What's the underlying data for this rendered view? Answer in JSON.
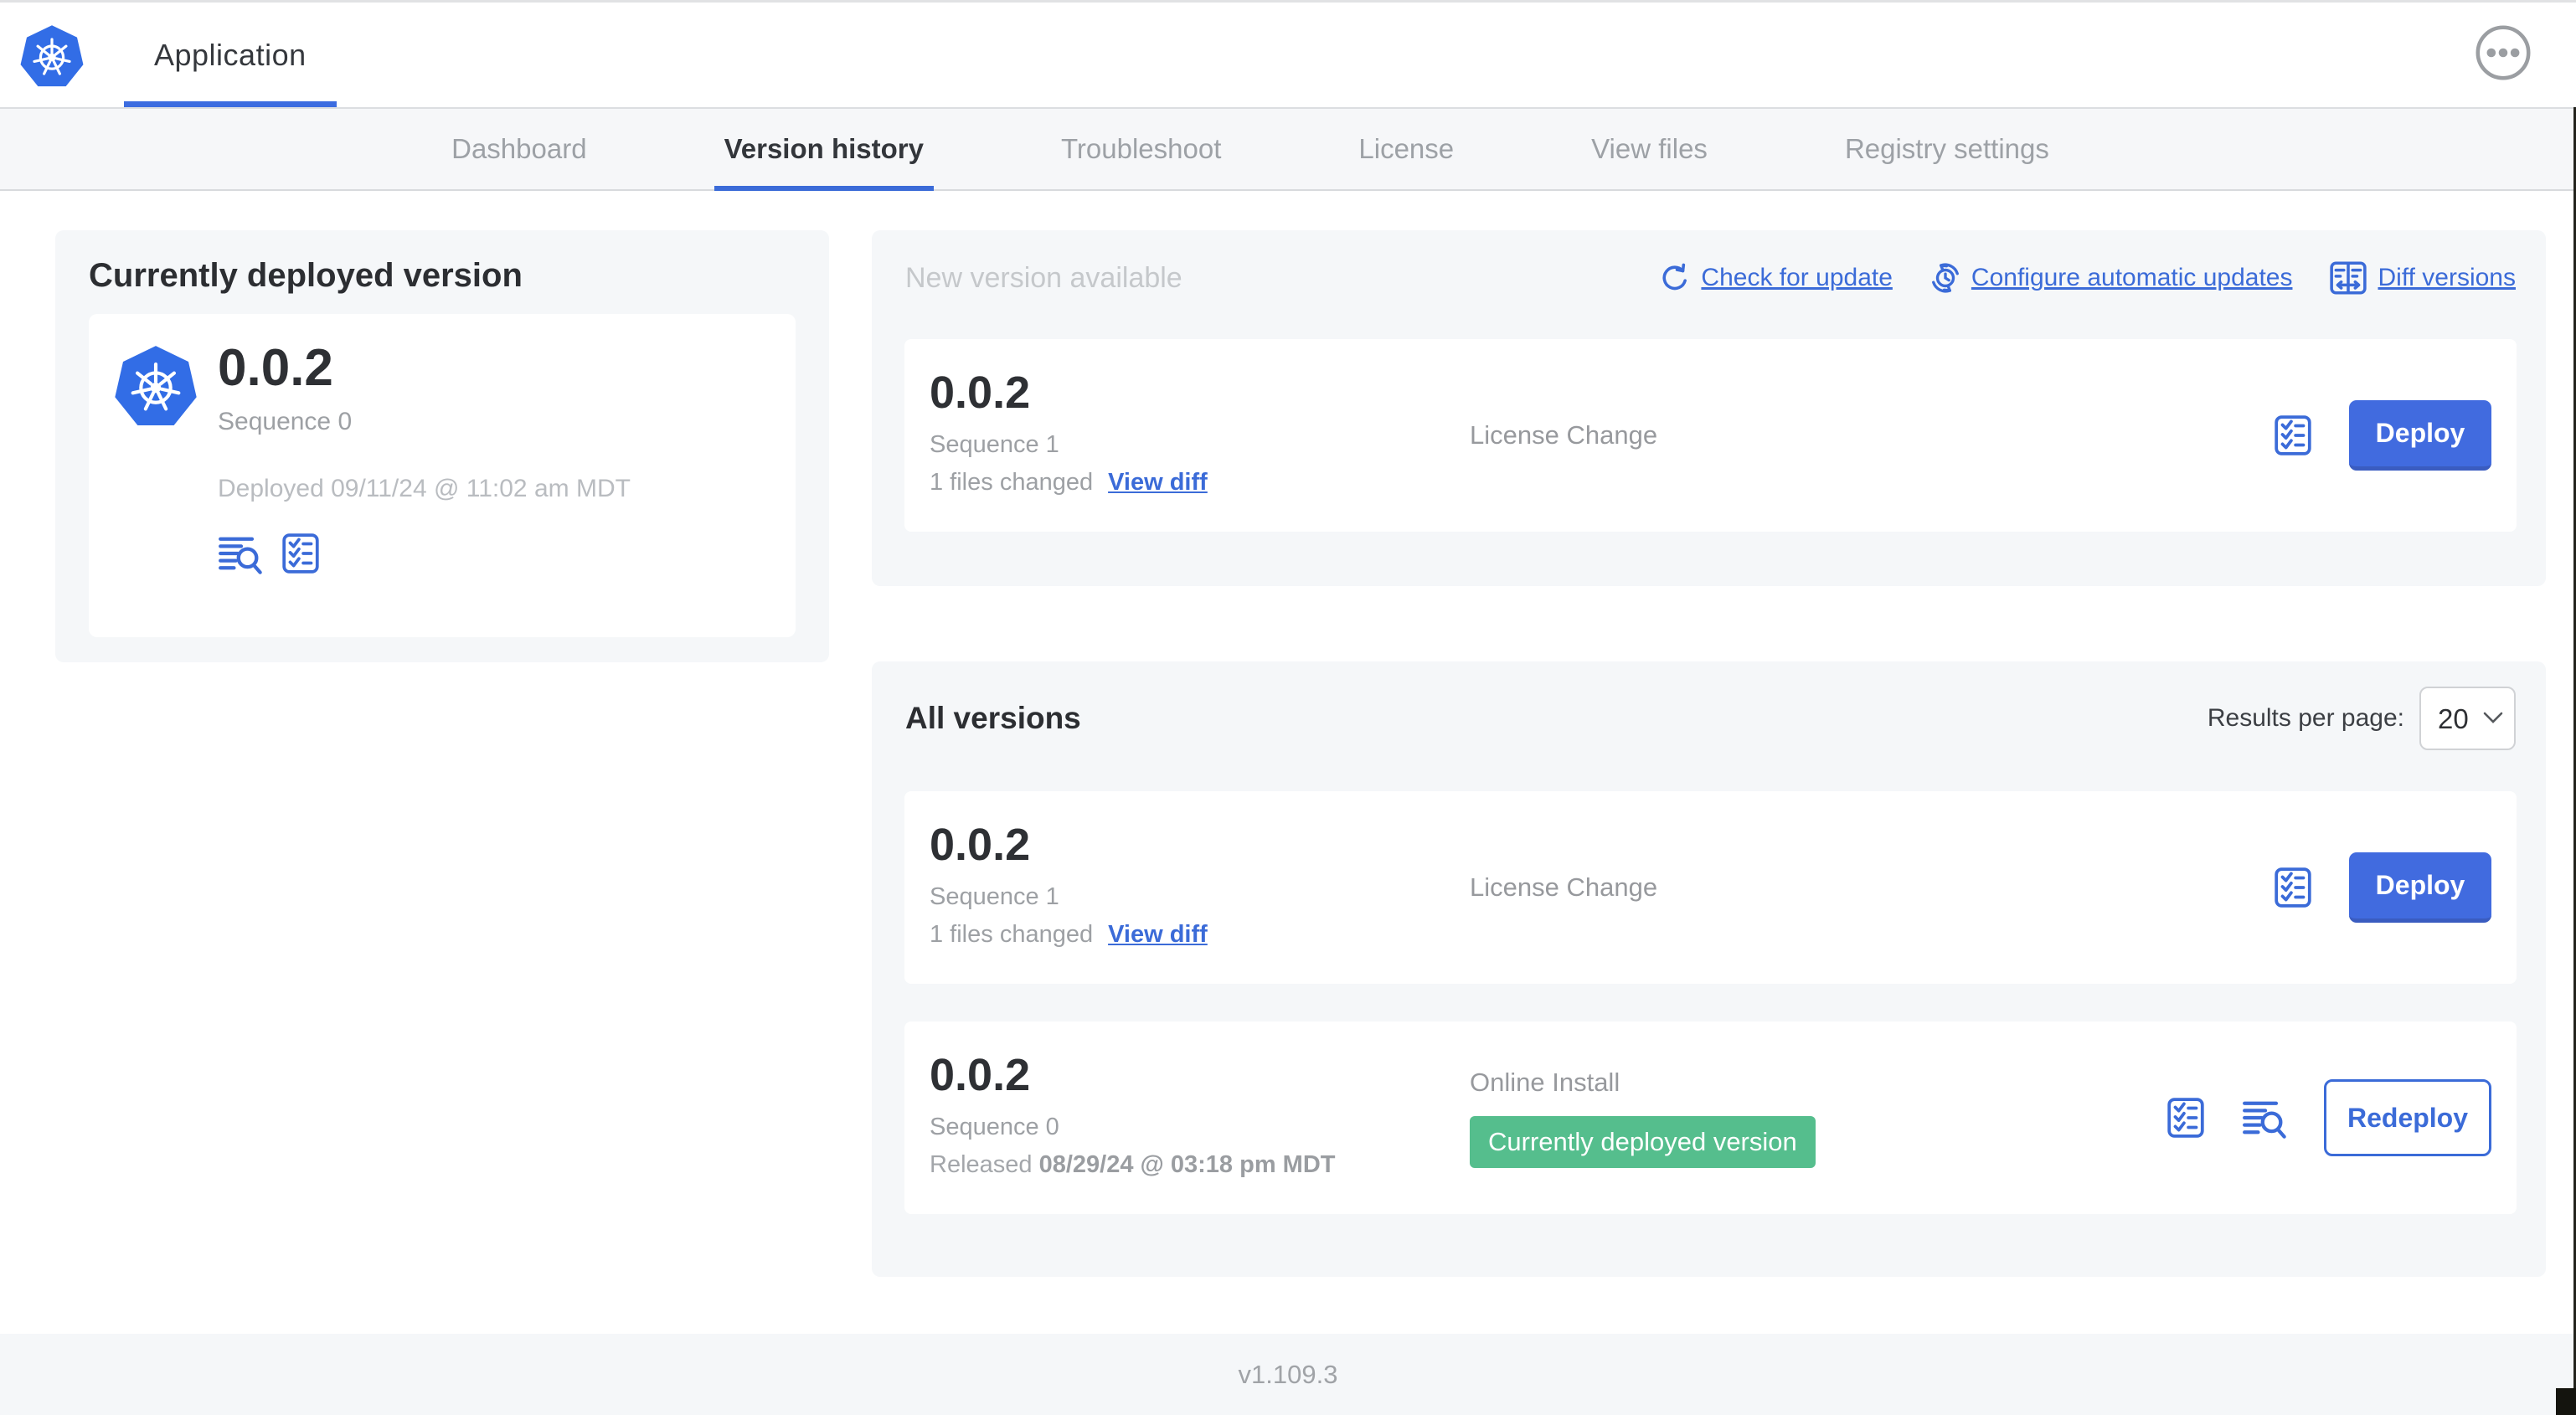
{
  "header": {
    "app_tab_label": "Application"
  },
  "nav": {
    "tabs": [
      {
        "label": "Dashboard",
        "active": false
      },
      {
        "label": "Version history",
        "active": true
      },
      {
        "label": "Troubleshoot",
        "active": false
      },
      {
        "label": "License",
        "active": false
      },
      {
        "label": "View files",
        "active": false
      },
      {
        "label": "Registry settings",
        "active": false
      }
    ]
  },
  "current_version": {
    "title": "Currently deployed version",
    "version": "0.0.2",
    "sequence": "Sequence 0",
    "deployed": "Deployed 09/11/24 @ 11:02 am MDT",
    "icons": [
      "logs-icon",
      "checklist-icon"
    ]
  },
  "new_version": {
    "title": "New version available",
    "actions": [
      {
        "icon": "refresh-icon",
        "label": "Check for update"
      },
      {
        "icon": "clock-refresh-icon",
        "label": "Configure automatic updates"
      },
      {
        "icon": "diff-icon",
        "label": "Diff versions"
      }
    ],
    "card": {
      "version": "0.0.2",
      "sequence": "Sequence 1",
      "files_changed": "1 files changed",
      "view_diff_label": "View diff",
      "change_type": "License Change",
      "deploy_label": "Deploy"
    }
  },
  "all_versions": {
    "title": "All versions",
    "results_per_page_label": "Results per page:",
    "results_per_page_value": "20",
    "rows": [
      {
        "version": "0.0.2",
        "sequence": "Sequence 1",
        "files_changed": "1 files changed",
        "view_diff_label": "View diff",
        "change_type": "License Change",
        "action_label": "Deploy"
      },
      {
        "version": "0.0.2",
        "sequence": "Sequence 0",
        "released_prefix": "Released",
        "released_date": "08/29/24 @ 03:18 pm MDT",
        "source": "Online Install",
        "badge": "Currently deployed version",
        "action_label": "Redeploy"
      }
    ]
  },
  "footer": {
    "version": "v1.109.3"
  },
  "colors": {
    "accent_blue": "#3b6bd8",
    "button_blue": "#416bdf",
    "badge_green": "#55be8d",
    "kubernetes_blue": "#326de6",
    "panel_gray": "#f5f7f9"
  }
}
